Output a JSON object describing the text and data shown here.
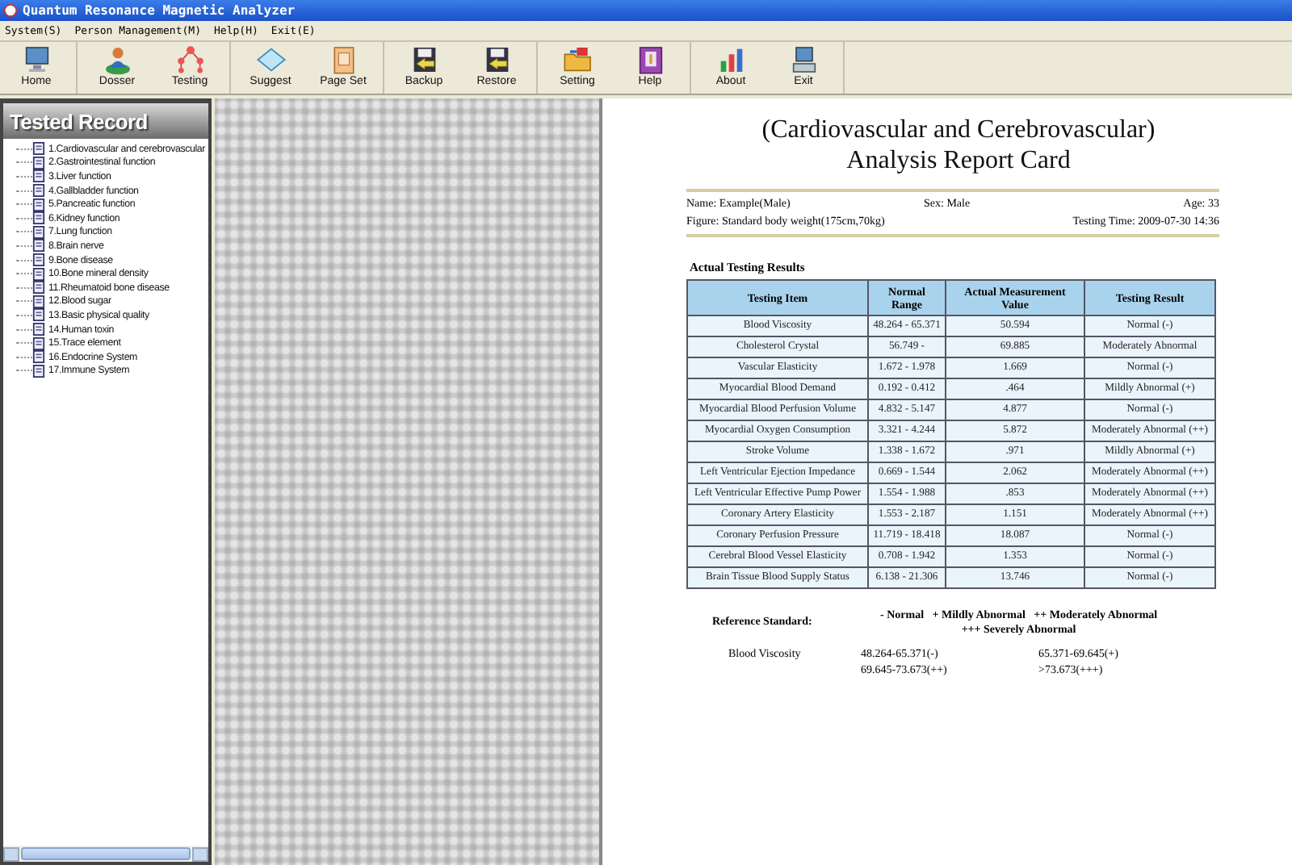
{
  "window": {
    "title": "Quantum Resonance Magnetic Analyzer"
  },
  "menu": [
    "System(S)",
    "Person Management(M)",
    "Help(H)",
    "Exit(E)"
  ],
  "toolbar": {
    "groups": [
      [
        {
          "label": "Home",
          "kind": "monitor"
        }
      ],
      [
        {
          "label": "Dosser",
          "kind": "person"
        },
        {
          "label": "Testing",
          "kind": "network"
        }
      ],
      [
        {
          "label": "Suggest",
          "kind": "diamond"
        },
        {
          "label": "Page Set",
          "kind": "page"
        }
      ],
      [
        {
          "label": "Backup",
          "kind": "disk"
        },
        {
          "label": "Restore",
          "kind": "disk"
        }
      ],
      [
        {
          "label": "Setting",
          "kind": "folder"
        },
        {
          "label": "Help",
          "kind": "book"
        }
      ],
      [
        {
          "label": "About",
          "kind": "chart"
        },
        {
          "label": "Exit",
          "kind": "computer"
        }
      ]
    ]
  },
  "sidebar": {
    "title": "Tested Record",
    "items": [
      "1.Cardiovascular and cerebrovascular",
      "2.Gastrointestinal function",
      "3.Liver function",
      "4.Gallbladder function",
      "5.Pancreatic function",
      "6.Kidney function",
      "7.Lung function",
      "8.Brain nerve",
      "9.Bone disease",
      "10.Bone mineral density",
      "11.Rheumatoid bone disease",
      "12.Blood sugar",
      "13.Basic physical quality",
      "14.Human toxin",
      "15.Trace element",
      "16.Endocrine System",
      "17.Immune System"
    ]
  },
  "report": {
    "title": "(Cardiovascular and Cerebrovascular)",
    "subtitle": "Analysis Report Card",
    "name": "Name: Example(Male)",
    "sex": "Sex: Male",
    "age": "Age: 33",
    "figure": "Figure: Standard body weight(175cm,70kg)",
    "testing_time": "Testing Time: 2009-07-30 14:36",
    "section": "Actual Testing Results",
    "columns": [
      "Testing Item",
      "Normal Range",
      "Actual Measurement Value",
      "Testing Result"
    ],
    "rows": [
      [
        "Blood Viscosity",
        "48.264 - 65.371",
        "50.594",
        "Normal (-)"
      ],
      [
        "Cholesterol Crystal",
        "56.749 -",
        "69.885",
        "Moderately Abnormal"
      ],
      [
        "Vascular Elasticity",
        "1.672 - 1.978",
        "1.669",
        "Normal (-)"
      ],
      [
        "Myocardial Blood Demand",
        "0.192 - 0.412",
        ".464",
        "Mildly Abnormal (+)"
      ],
      [
        "Myocardial Blood Perfusion Volume",
        "4.832 - 5.147",
        "4.877",
        "Normal (-)"
      ],
      [
        "Myocardial Oxygen Consumption",
        "3.321 - 4.244",
        "5.872",
        "Moderately Abnormal (++)"
      ],
      [
        "Stroke Volume",
        "1.338 - 1.672",
        ".971",
        "Mildly Abnormal (+)"
      ],
      [
        "Left Ventricular Ejection Impedance",
        "0.669 - 1.544",
        "2.062",
        "Moderately Abnormal (++)"
      ],
      [
        "Left Ventricular Effective Pump Power",
        "1.554 - 1.988",
        ".853",
        "Moderately Abnormal (++)"
      ],
      [
        "Coronary Artery Elasticity",
        "1.553 - 2.187",
        "1.151",
        "Moderately Abnormal (++)"
      ],
      [
        "Coronary Perfusion Pressure",
        "11.719 - 18.418",
        "18.087",
        "Normal (-)"
      ],
      [
        "Cerebral Blood Vessel Elasticity",
        "0.708 - 1.942",
        "1.353",
        "Normal (-)"
      ],
      [
        "Brain Tissue Blood Supply Status",
        "6.138 - 21.306",
        "13.746",
        "Normal (-)"
      ]
    ],
    "reference_label": "Reference Standard:",
    "reference_line_1": "- Normal   + Mildly Abnormal   ++ Moderately Abnormal",
    "reference_line_2": "+++ Severely Abnormal",
    "reference_item": "Blood Viscosity",
    "reference_ranges": [
      "48.264-65.371(-)",
      "65.371-69.645(+)",
      "69.645-73.673(++)",
      ">73.673(+++)"
    ]
  }
}
